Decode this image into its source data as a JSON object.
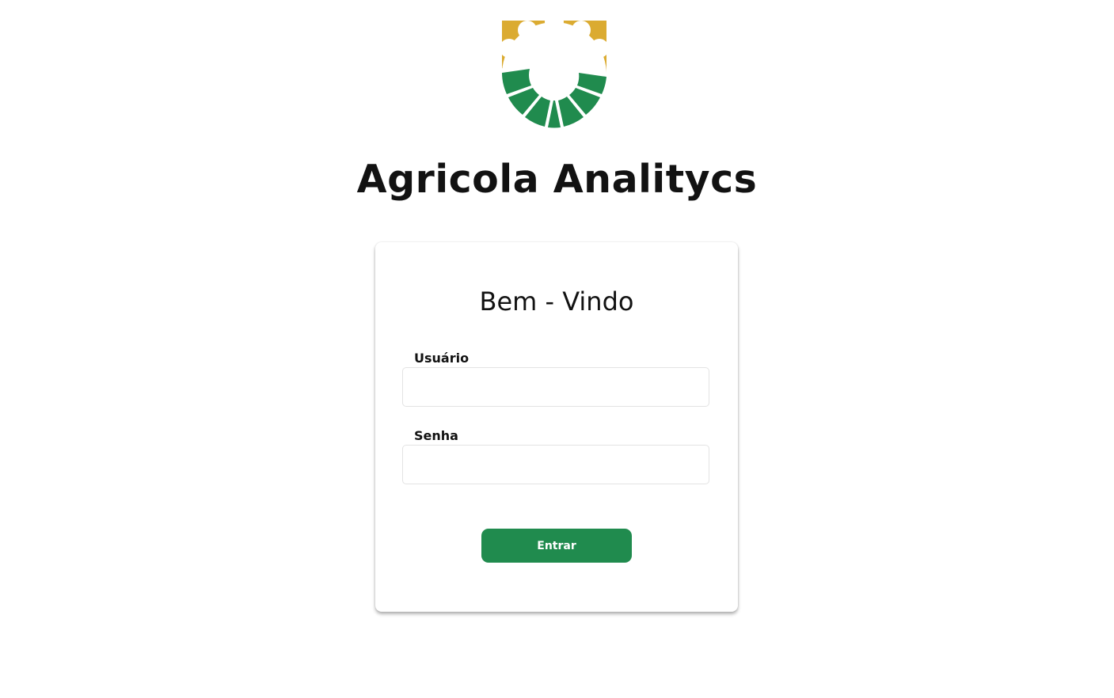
{
  "header": {
    "logo": "agricola-gear-logo",
    "title": "Agricola Analitycs"
  },
  "login": {
    "welcome": "Bem - Vindo",
    "username_label": "Usuário",
    "username_value": "",
    "password_label": "Senha",
    "password_value": "",
    "submit_label": "Entrar"
  },
  "colors": {
    "accent": "#208b4e",
    "logo_gold": "#dbab31",
    "logo_green": "#208b4e",
    "text": "#121212"
  }
}
